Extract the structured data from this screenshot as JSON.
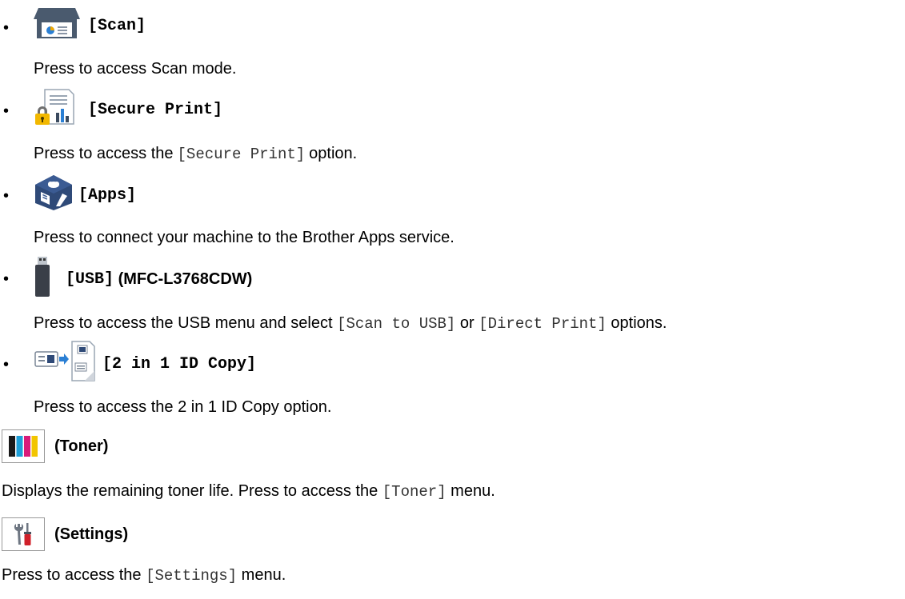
{
  "items": [
    {
      "icon": "scanner-icon",
      "title": "[Scan]",
      "desc_text": "Press to access Scan mode."
    },
    {
      "icon": "secure-print-icon",
      "title": "[Secure Print]",
      "desc_pre": "Press to access the ",
      "desc_code": "[Secure Print]",
      "desc_post": " option."
    },
    {
      "icon": "apps-cube-icon",
      "title": "[Apps]",
      "desc_text": "Press to connect your machine to the Brother Apps service."
    },
    {
      "icon": "usb-drive-icon",
      "title": "[USB]",
      "title_suffix": " (MFC-L3768CDW)",
      "desc_pre": "Press to access the USB menu and select ",
      "desc_code1": "[Scan to USB]",
      "desc_mid": " or ",
      "desc_code2": "[Direct Print]",
      "desc_post": " options."
    },
    {
      "icon": "id-copy-icon",
      "title": "[2 in 1 ID Copy]",
      "desc_text": "Press to access the 2 in 1 ID Copy option."
    }
  ],
  "toner": {
    "icon": "toner-icon",
    "title": "(Toner)",
    "desc_pre": "Displays the remaining toner life. Press to access the ",
    "desc_code": "[Toner]",
    "desc_post": " menu.",
    "colors": [
      "#1a1a1a",
      "#1e9fd8",
      "#d81b7a",
      "#f2c500"
    ]
  },
  "settings": {
    "icon": "settings-tools-icon",
    "title": "(Settings)",
    "desc_pre": "Press to access the ",
    "desc_code": "[Settings]",
    "desc_post": " menu."
  },
  "bullet_char": "•"
}
